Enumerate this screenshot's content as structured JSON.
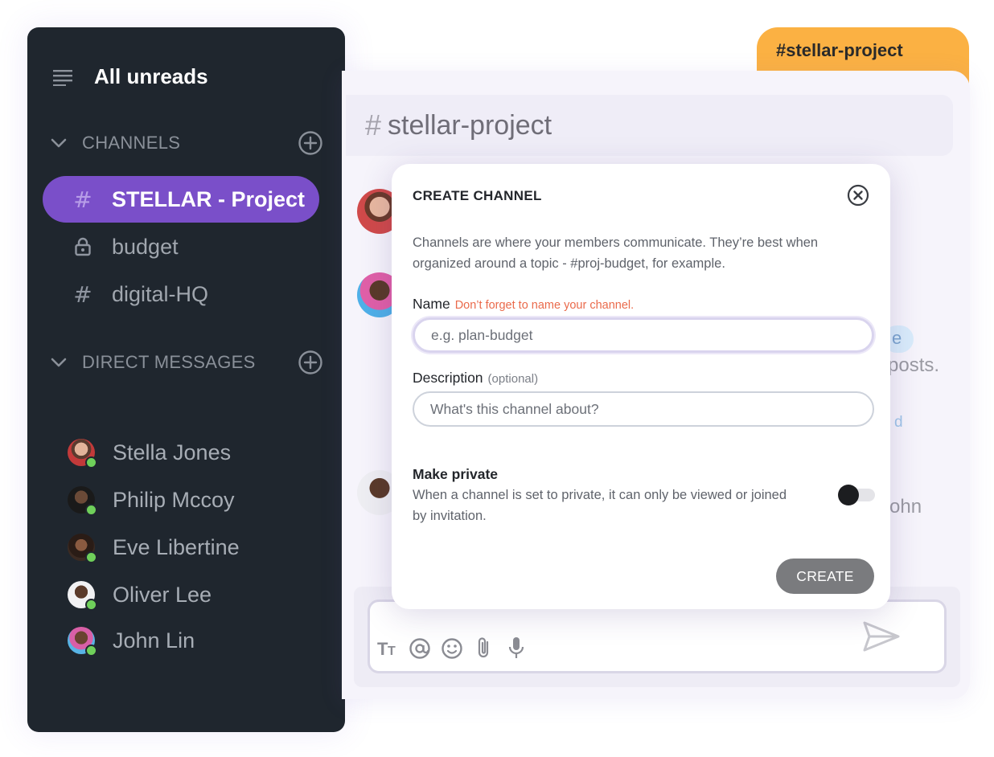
{
  "sidebar": {
    "title": "All unreads",
    "channels_label": "CHANNELS",
    "channels": [
      {
        "label": "STELLAR - Project",
        "icon": "hash-icon",
        "active": true
      },
      {
        "label": "budget",
        "icon": "lock-icon",
        "active": false
      },
      {
        "label": "digital-HQ",
        "icon": "hash-icon",
        "active": false
      }
    ],
    "dm_label": "DIRECT MESSAGES",
    "direct_messages": [
      {
        "name": "Stella Jones",
        "status": "online"
      },
      {
        "name": "Philip Mccoy",
        "status": "online"
      },
      {
        "name": "Eve Libertine",
        "status": "online"
      },
      {
        "name": "Oliver Lee",
        "status": "online"
      },
      {
        "name": "John Lin",
        "status": "online"
      }
    ]
  },
  "tab": {
    "label": "#stellar-project"
  },
  "channel_header": {
    "hash": "#",
    "title": "stellar-project"
  },
  "background_fragments": {
    "bubble": "e",
    "posts": "posts.",
    "link": "d",
    "john": "ohn"
  },
  "modal": {
    "title": "CREATE CHANNEL",
    "description": "Channels are where your members communicate. They’re best when organized around a topic - #proj-budget, for example.",
    "name_label": "Name",
    "name_warning": "Don’t forget to name your channel.",
    "name_placeholder": "e.g. plan-budget",
    "description_label": "Description",
    "description_optional": "(optional)",
    "description_placeholder": "What's this channel about?",
    "private_title": "Make private",
    "private_description": "When a channel is set to private, it can only be viewed or joined by invitation.",
    "private_enabled": false,
    "create_label": "CREATE"
  },
  "colors": {
    "sidebar_bg": "#1f262e",
    "active_channel": "#7a4fc9",
    "tab": "#fbb143",
    "online": "#6fd05a",
    "warning": "#ea6a4b",
    "create_button": "#7a7b7e"
  }
}
